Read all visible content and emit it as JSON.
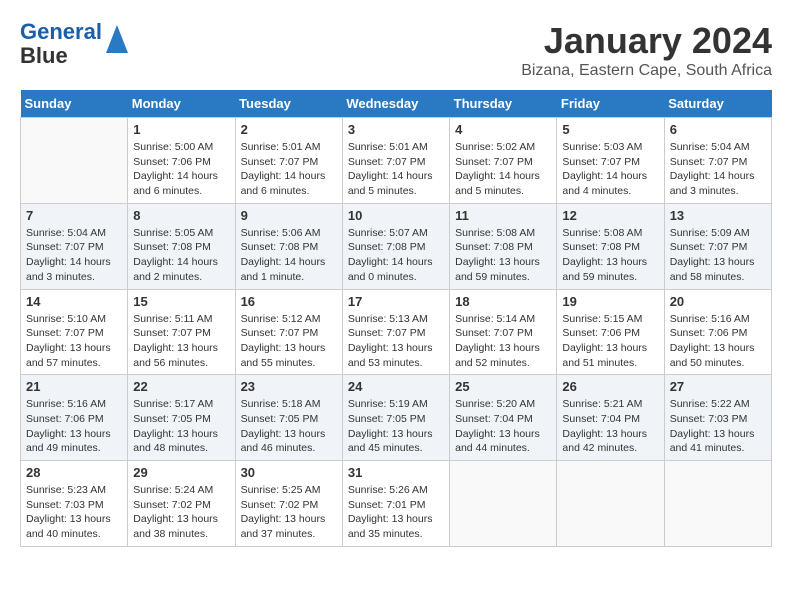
{
  "header": {
    "logo_line1": "General",
    "logo_line2": "Blue",
    "month_title": "January 2024",
    "location": "Bizana, Eastern Cape, South Africa"
  },
  "weekdays": [
    "Sunday",
    "Monday",
    "Tuesday",
    "Wednesday",
    "Thursday",
    "Friday",
    "Saturday"
  ],
  "weeks": [
    {
      "row_class": "normal-row",
      "days": [
        {
          "num": "",
          "empty": true
        },
        {
          "num": "1",
          "sunrise": "Sunrise: 5:00 AM",
          "sunset": "Sunset: 7:06 PM",
          "daylight": "Daylight: 14 hours and 6 minutes."
        },
        {
          "num": "2",
          "sunrise": "Sunrise: 5:01 AM",
          "sunset": "Sunset: 7:07 PM",
          "daylight": "Daylight: 14 hours and 6 minutes."
        },
        {
          "num": "3",
          "sunrise": "Sunrise: 5:01 AM",
          "sunset": "Sunset: 7:07 PM",
          "daylight": "Daylight: 14 hours and 5 minutes."
        },
        {
          "num": "4",
          "sunrise": "Sunrise: 5:02 AM",
          "sunset": "Sunset: 7:07 PM",
          "daylight": "Daylight: 14 hours and 5 minutes."
        },
        {
          "num": "5",
          "sunrise": "Sunrise: 5:03 AM",
          "sunset": "Sunset: 7:07 PM",
          "daylight": "Daylight: 14 hours and 4 minutes."
        },
        {
          "num": "6",
          "sunrise": "Sunrise: 5:04 AM",
          "sunset": "Sunset: 7:07 PM",
          "daylight": "Daylight: 14 hours and 3 minutes."
        }
      ]
    },
    {
      "row_class": "alt-row",
      "days": [
        {
          "num": "7",
          "sunrise": "Sunrise: 5:04 AM",
          "sunset": "Sunset: 7:07 PM",
          "daylight": "Daylight: 14 hours and 3 minutes."
        },
        {
          "num": "8",
          "sunrise": "Sunrise: 5:05 AM",
          "sunset": "Sunset: 7:08 PM",
          "daylight": "Daylight: 14 hours and 2 minutes."
        },
        {
          "num": "9",
          "sunrise": "Sunrise: 5:06 AM",
          "sunset": "Sunset: 7:08 PM",
          "daylight": "Daylight: 14 hours and 1 minute."
        },
        {
          "num": "10",
          "sunrise": "Sunrise: 5:07 AM",
          "sunset": "Sunset: 7:08 PM",
          "daylight": "Daylight: 14 hours and 0 minutes."
        },
        {
          "num": "11",
          "sunrise": "Sunrise: 5:08 AM",
          "sunset": "Sunset: 7:08 PM",
          "daylight": "Daylight: 13 hours and 59 minutes."
        },
        {
          "num": "12",
          "sunrise": "Sunrise: 5:08 AM",
          "sunset": "Sunset: 7:08 PM",
          "daylight": "Daylight: 13 hours and 59 minutes."
        },
        {
          "num": "13",
          "sunrise": "Sunrise: 5:09 AM",
          "sunset": "Sunset: 7:07 PM",
          "daylight": "Daylight: 13 hours and 58 minutes."
        }
      ]
    },
    {
      "row_class": "normal-row",
      "days": [
        {
          "num": "14",
          "sunrise": "Sunrise: 5:10 AM",
          "sunset": "Sunset: 7:07 PM",
          "daylight": "Daylight: 13 hours and 57 minutes."
        },
        {
          "num": "15",
          "sunrise": "Sunrise: 5:11 AM",
          "sunset": "Sunset: 7:07 PM",
          "daylight": "Daylight: 13 hours and 56 minutes."
        },
        {
          "num": "16",
          "sunrise": "Sunrise: 5:12 AM",
          "sunset": "Sunset: 7:07 PM",
          "daylight": "Daylight: 13 hours and 55 minutes."
        },
        {
          "num": "17",
          "sunrise": "Sunrise: 5:13 AM",
          "sunset": "Sunset: 7:07 PM",
          "daylight": "Daylight: 13 hours and 53 minutes."
        },
        {
          "num": "18",
          "sunrise": "Sunrise: 5:14 AM",
          "sunset": "Sunset: 7:07 PM",
          "daylight": "Daylight: 13 hours and 52 minutes."
        },
        {
          "num": "19",
          "sunrise": "Sunrise: 5:15 AM",
          "sunset": "Sunset: 7:06 PM",
          "daylight": "Daylight: 13 hours and 51 minutes."
        },
        {
          "num": "20",
          "sunrise": "Sunrise: 5:16 AM",
          "sunset": "Sunset: 7:06 PM",
          "daylight": "Daylight: 13 hours and 50 minutes."
        }
      ]
    },
    {
      "row_class": "alt-row",
      "days": [
        {
          "num": "21",
          "sunrise": "Sunrise: 5:16 AM",
          "sunset": "Sunset: 7:06 PM",
          "daylight": "Daylight: 13 hours and 49 minutes."
        },
        {
          "num": "22",
          "sunrise": "Sunrise: 5:17 AM",
          "sunset": "Sunset: 7:05 PM",
          "daylight": "Daylight: 13 hours and 48 minutes."
        },
        {
          "num": "23",
          "sunrise": "Sunrise: 5:18 AM",
          "sunset": "Sunset: 7:05 PM",
          "daylight": "Daylight: 13 hours and 46 minutes."
        },
        {
          "num": "24",
          "sunrise": "Sunrise: 5:19 AM",
          "sunset": "Sunset: 7:05 PM",
          "daylight": "Daylight: 13 hours and 45 minutes."
        },
        {
          "num": "25",
          "sunrise": "Sunrise: 5:20 AM",
          "sunset": "Sunset: 7:04 PM",
          "daylight": "Daylight: 13 hours and 44 minutes."
        },
        {
          "num": "26",
          "sunrise": "Sunrise: 5:21 AM",
          "sunset": "Sunset: 7:04 PM",
          "daylight": "Daylight: 13 hours and 42 minutes."
        },
        {
          "num": "27",
          "sunrise": "Sunrise: 5:22 AM",
          "sunset": "Sunset: 7:03 PM",
          "daylight": "Daylight: 13 hours and 41 minutes."
        }
      ]
    },
    {
      "row_class": "normal-row",
      "days": [
        {
          "num": "28",
          "sunrise": "Sunrise: 5:23 AM",
          "sunset": "Sunset: 7:03 PM",
          "daylight": "Daylight: 13 hours and 40 minutes."
        },
        {
          "num": "29",
          "sunrise": "Sunrise: 5:24 AM",
          "sunset": "Sunset: 7:02 PM",
          "daylight": "Daylight: 13 hours and 38 minutes."
        },
        {
          "num": "30",
          "sunrise": "Sunrise: 5:25 AM",
          "sunset": "Sunset: 7:02 PM",
          "daylight": "Daylight: 13 hours and 37 minutes."
        },
        {
          "num": "31",
          "sunrise": "Sunrise: 5:26 AM",
          "sunset": "Sunset: 7:01 PM",
          "daylight": "Daylight: 13 hours and 35 minutes."
        },
        {
          "num": "",
          "empty": true
        },
        {
          "num": "",
          "empty": true
        },
        {
          "num": "",
          "empty": true
        }
      ]
    }
  ]
}
